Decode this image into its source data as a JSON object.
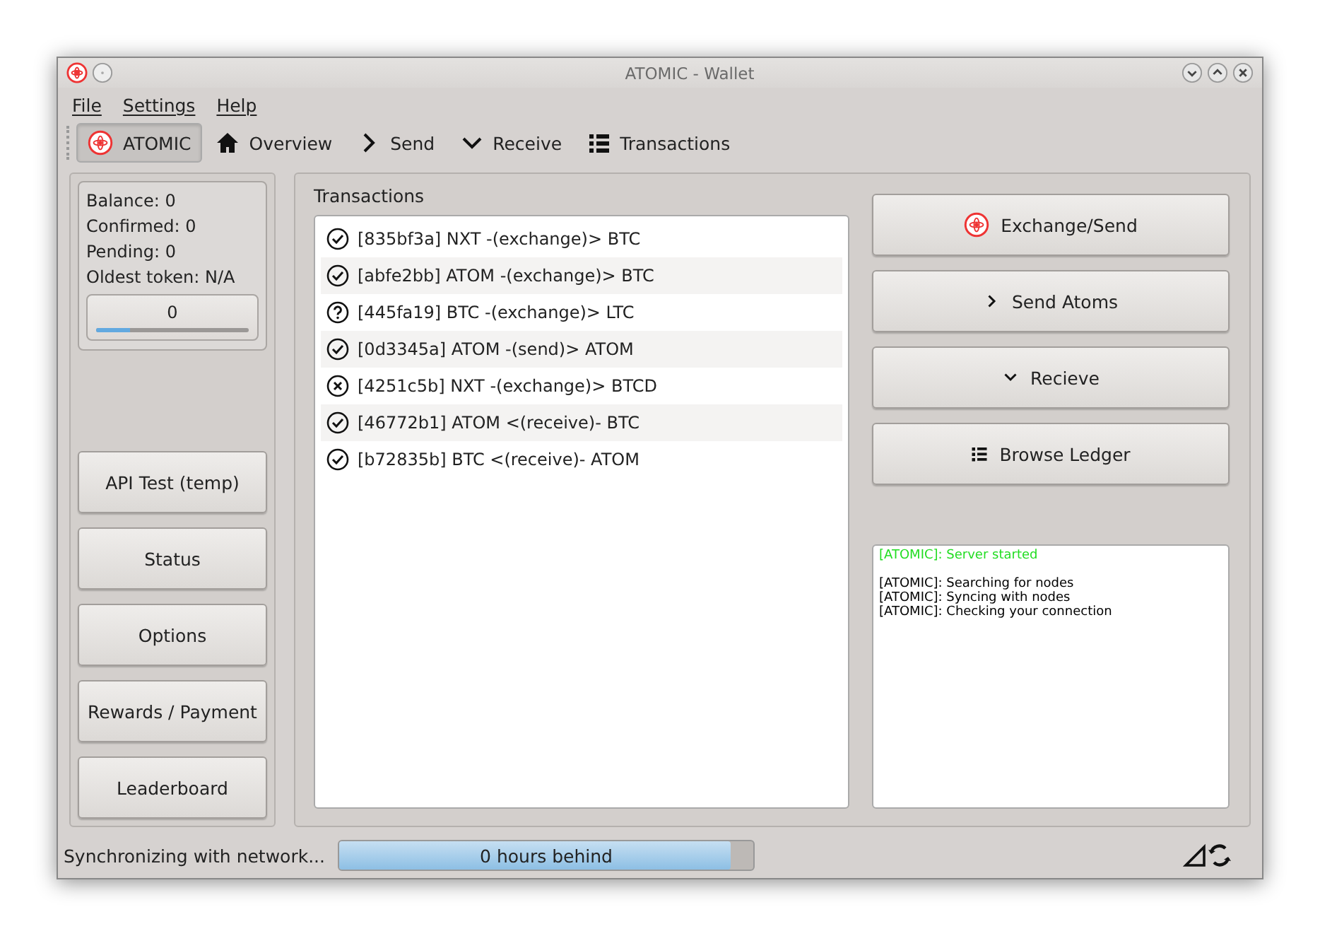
{
  "window": {
    "title": "ATOMIC - Wallet"
  },
  "menu": [
    "File",
    "Settings",
    "Help"
  ],
  "toolbar": [
    {
      "label": "ATOMIC",
      "kind": "atom",
      "selected": true
    },
    {
      "label": "Overview",
      "kind": "home",
      "selected": false
    },
    {
      "label": "Send",
      "kind": "forward",
      "selected": false
    },
    {
      "label": "Receive",
      "kind": "down",
      "selected": false
    },
    {
      "label": "Transactions",
      "kind": "list",
      "selected": false
    }
  ],
  "summary": {
    "lines": [
      "Balance: 0",
      "Confirmed: 0",
      "Pending: 0",
      "Oldest token: N/A"
    ],
    "counter": "0",
    "level": 0.22
  },
  "side_buttons": [
    "API Test (temp)",
    "Status",
    "Options",
    "Rewards / Payment",
    "Leaderboard"
  ],
  "transactions": {
    "title": "Transactions",
    "rows": [
      {
        "text": "[835bf3a] NXT -(exchange)> BTC",
        "kind": "ok"
      },
      {
        "text": "[abfe2bb] ATOM -(exchange)> BTC",
        "kind": "ok"
      },
      {
        "text": "[445fa19] BTC -(exchange)> LTC",
        "kind": "unknown"
      },
      {
        "text": "[0d3345a] ATOM -(send)> ATOM",
        "kind": "ok"
      },
      {
        "text": "[4251c5b] NXT -(exchange)> BTCD",
        "kind": "failed"
      },
      {
        "text": "[46772b1] ATOM <(receive)- BTC",
        "kind": "ok"
      },
      {
        "text": "[b72835b] BTC <(receive)- ATOM",
        "kind": "ok"
      }
    ]
  },
  "actions": [
    {
      "label": "Exchange/Send",
      "kind": "atom"
    },
    {
      "label": "Send Atoms",
      "kind": "forward"
    },
    {
      "label": "Recieve",
      "kind": "down"
    },
    {
      "label": "Browse Ledger",
      "kind": "list"
    }
  ],
  "log": [
    {
      "text": "[ATOMIC]: Server started",
      "color": "#22dd22"
    },
    {
      "text": "[ATOMIC]: Searching for nodes",
      "color": "#000000"
    },
    {
      "text": "[ATOMIC]: Syncing with nodes",
      "color": "#000000"
    },
    {
      "text": "[ATOMIC]: Checking your connection",
      "color": "#000000"
    }
  ],
  "status_bar": {
    "message": "Synchronizing with network...",
    "progress_text": "0 hours behind",
    "level": 0.945
  }
}
